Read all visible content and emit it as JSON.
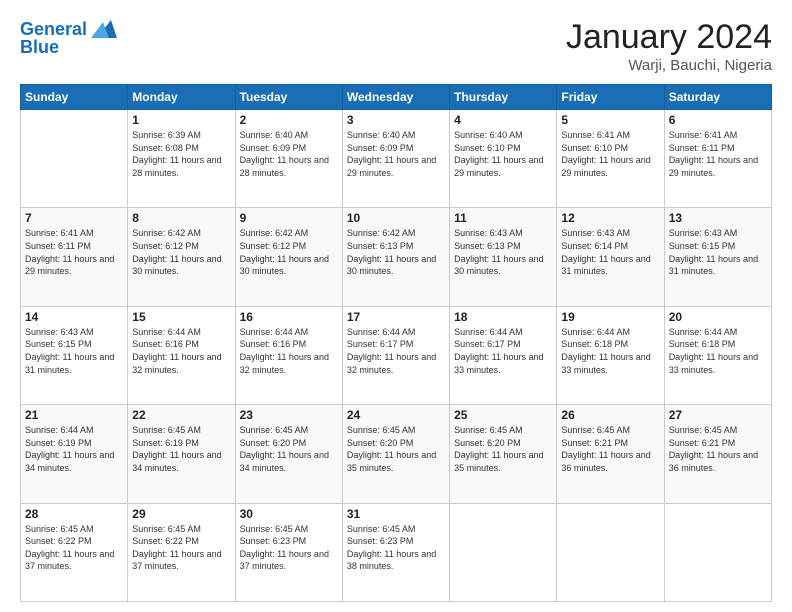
{
  "header": {
    "logo_line1": "General",
    "logo_line2": "Blue",
    "month": "January 2024",
    "location": "Warji, Bauchi, Nigeria"
  },
  "days_of_week": [
    "Sunday",
    "Monday",
    "Tuesday",
    "Wednesday",
    "Thursday",
    "Friday",
    "Saturday"
  ],
  "weeks": [
    [
      {
        "day": "",
        "sunrise": "",
        "sunset": "",
        "daylight": ""
      },
      {
        "day": "1",
        "sunrise": "Sunrise: 6:39 AM",
        "sunset": "Sunset: 6:08 PM",
        "daylight": "Daylight: 11 hours and 28 minutes."
      },
      {
        "day": "2",
        "sunrise": "Sunrise: 6:40 AM",
        "sunset": "Sunset: 6:09 PM",
        "daylight": "Daylight: 11 hours and 28 minutes."
      },
      {
        "day": "3",
        "sunrise": "Sunrise: 6:40 AM",
        "sunset": "Sunset: 6:09 PM",
        "daylight": "Daylight: 11 hours and 29 minutes."
      },
      {
        "day": "4",
        "sunrise": "Sunrise: 6:40 AM",
        "sunset": "Sunset: 6:10 PM",
        "daylight": "Daylight: 11 hours and 29 minutes."
      },
      {
        "day": "5",
        "sunrise": "Sunrise: 6:41 AM",
        "sunset": "Sunset: 6:10 PM",
        "daylight": "Daylight: 11 hours and 29 minutes."
      },
      {
        "day": "6",
        "sunrise": "Sunrise: 6:41 AM",
        "sunset": "Sunset: 6:11 PM",
        "daylight": "Daylight: 11 hours and 29 minutes."
      }
    ],
    [
      {
        "day": "7",
        "sunrise": "Sunrise: 6:41 AM",
        "sunset": "Sunset: 6:11 PM",
        "daylight": "Daylight: 11 hours and 29 minutes."
      },
      {
        "day": "8",
        "sunrise": "Sunrise: 6:42 AM",
        "sunset": "Sunset: 6:12 PM",
        "daylight": "Daylight: 11 hours and 30 minutes."
      },
      {
        "day": "9",
        "sunrise": "Sunrise: 6:42 AM",
        "sunset": "Sunset: 6:12 PM",
        "daylight": "Daylight: 11 hours and 30 minutes."
      },
      {
        "day": "10",
        "sunrise": "Sunrise: 6:42 AM",
        "sunset": "Sunset: 6:13 PM",
        "daylight": "Daylight: 11 hours and 30 minutes."
      },
      {
        "day": "11",
        "sunrise": "Sunrise: 6:43 AM",
        "sunset": "Sunset: 6:13 PM",
        "daylight": "Daylight: 11 hours and 30 minutes."
      },
      {
        "day": "12",
        "sunrise": "Sunrise: 6:43 AM",
        "sunset": "Sunset: 6:14 PM",
        "daylight": "Daylight: 11 hours and 31 minutes."
      },
      {
        "day": "13",
        "sunrise": "Sunrise: 6:43 AM",
        "sunset": "Sunset: 6:15 PM",
        "daylight": "Daylight: 11 hours and 31 minutes."
      }
    ],
    [
      {
        "day": "14",
        "sunrise": "Sunrise: 6:43 AM",
        "sunset": "Sunset: 6:15 PM",
        "daylight": "Daylight: 11 hours and 31 minutes."
      },
      {
        "day": "15",
        "sunrise": "Sunrise: 6:44 AM",
        "sunset": "Sunset: 6:16 PM",
        "daylight": "Daylight: 11 hours and 32 minutes."
      },
      {
        "day": "16",
        "sunrise": "Sunrise: 6:44 AM",
        "sunset": "Sunset: 6:16 PM",
        "daylight": "Daylight: 11 hours and 32 minutes."
      },
      {
        "day": "17",
        "sunrise": "Sunrise: 6:44 AM",
        "sunset": "Sunset: 6:17 PM",
        "daylight": "Daylight: 11 hours and 32 minutes."
      },
      {
        "day": "18",
        "sunrise": "Sunrise: 6:44 AM",
        "sunset": "Sunset: 6:17 PM",
        "daylight": "Daylight: 11 hours and 33 minutes."
      },
      {
        "day": "19",
        "sunrise": "Sunrise: 6:44 AM",
        "sunset": "Sunset: 6:18 PM",
        "daylight": "Daylight: 11 hours and 33 minutes."
      },
      {
        "day": "20",
        "sunrise": "Sunrise: 6:44 AM",
        "sunset": "Sunset: 6:18 PM",
        "daylight": "Daylight: 11 hours and 33 minutes."
      }
    ],
    [
      {
        "day": "21",
        "sunrise": "Sunrise: 6:44 AM",
        "sunset": "Sunset: 6:19 PM",
        "daylight": "Daylight: 11 hours and 34 minutes."
      },
      {
        "day": "22",
        "sunrise": "Sunrise: 6:45 AM",
        "sunset": "Sunset: 6:19 PM",
        "daylight": "Daylight: 11 hours and 34 minutes."
      },
      {
        "day": "23",
        "sunrise": "Sunrise: 6:45 AM",
        "sunset": "Sunset: 6:20 PM",
        "daylight": "Daylight: 11 hours and 34 minutes."
      },
      {
        "day": "24",
        "sunrise": "Sunrise: 6:45 AM",
        "sunset": "Sunset: 6:20 PM",
        "daylight": "Daylight: 11 hours and 35 minutes."
      },
      {
        "day": "25",
        "sunrise": "Sunrise: 6:45 AM",
        "sunset": "Sunset: 6:20 PM",
        "daylight": "Daylight: 11 hours and 35 minutes."
      },
      {
        "day": "26",
        "sunrise": "Sunrise: 6:45 AM",
        "sunset": "Sunset: 6:21 PM",
        "daylight": "Daylight: 11 hours and 36 minutes."
      },
      {
        "day": "27",
        "sunrise": "Sunrise: 6:45 AM",
        "sunset": "Sunset: 6:21 PM",
        "daylight": "Daylight: 11 hours and 36 minutes."
      }
    ],
    [
      {
        "day": "28",
        "sunrise": "Sunrise: 6:45 AM",
        "sunset": "Sunset: 6:22 PM",
        "daylight": "Daylight: 11 hours and 37 minutes."
      },
      {
        "day": "29",
        "sunrise": "Sunrise: 6:45 AM",
        "sunset": "Sunset: 6:22 PM",
        "daylight": "Daylight: 11 hours and 37 minutes."
      },
      {
        "day": "30",
        "sunrise": "Sunrise: 6:45 AM",
        "sunset": "Sunset: 6:23 PM",
        "daylight": "Daylight: 11 hours and 37 minutes."
      },
      {
        "day": "31",
        "sunrise": "Sunrise: 6:45 AM",
        "sunset": "Sunset: 6:23 PM",
        "daylight": "Daylight: 11 hours and 38 minutes."
      },
      {
        "day": "",
        "sunrise": "",
        "sunset": "",
        "daylight": ""
      },
      {
        "day": "",
        "sunrise": "",
        "sunset": "",
        "daylight": ""
      },
      {
        "day": "",
        "sunrise": "",
        "sunset": "",
        "daylight": ""
      }
    ]
  ]
}
